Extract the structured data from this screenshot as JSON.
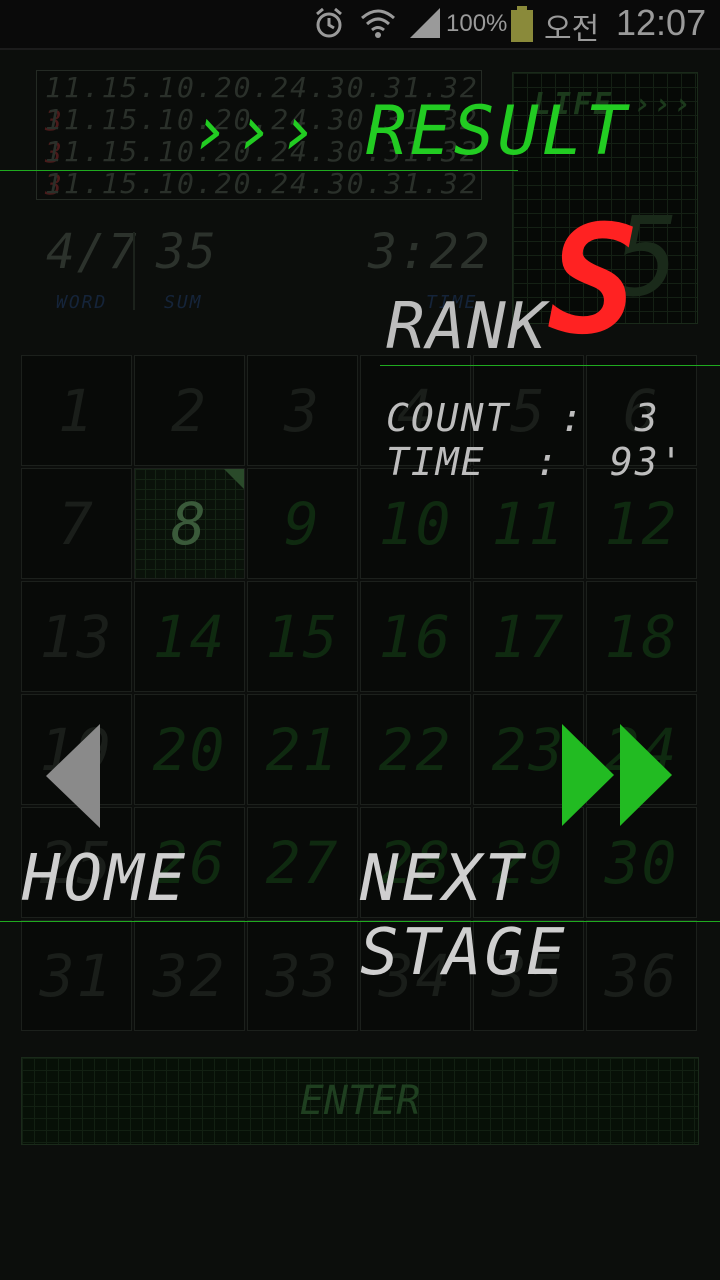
{
  "status_bar": {
    "battery": "100%",
    "ampm": "오전",
    "time": "12:07"
  },
  "history": [
    {
      "numbers": "11.15.10.20.24.30.31.32",
      "bonus": "3"
    },
    {
      "numbers": "11.15.10.20.24.30.31.32",
      "bonus": "3"
    },
    {
      "numbers": "11.15.10.20.24.30.31.32",
      "bonus": "3"
    },
    {
      "numbers": "11.15.10.20.24.30.31.32",
      "bonus": ""
    }
  ],
  "life": {
    "label": "LIFE",
    "chevrons": "›››",
    "value": "5"
  },
  "stats": {
    "word_value": "4/7",
    "word_label": "WORD",
    "sum_value": "35",
    "sum_label": "SUM",
    "time_value": "3:22",
    "time_label": "TIME"
  },
  "grid": {
    "cells": [
      "1",
      "2",
      "3",
      "4",
      "5",
      "6",
      "7",
      "8",
      "9",
      "10",
      "11",
      "12",
      "13",
      "14",
      "15",
      "16",
      "17",
      "18",
      "19",
      "20",
      "21",
      "22",
      "23",
      "24",
      "25",
      "26",
      "27",
      "28",
      "29",
      "30",
      "31",
      "32",
      "33",
      "34",
      "35",
      "36"
    ],
    "selected": "8"
  },
  "enter_label": "ENTER",
  "result": {
    "chevrons": "›››",
    "title": "RESULT",
    "rank_label": "RANK",
    "rank_value": "S",
    "count_line": "COUNT  :  3",
    "time_line": "TIME  :  93'"
  },
  "nav": {
    "home_label": "HOME",
    "next_label": "NEXT STAGE"
  },
  "colors": {
    "accent": "#22cc22",
    "rank": "#ff2222",
    "arrow_next": "#22bb22",
    "arrow_home": "#8a8a8a"
  }
}
